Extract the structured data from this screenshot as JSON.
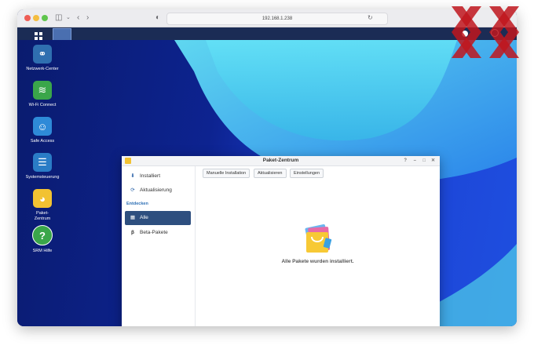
{
  "browser": {
    "address": "192.168.1.238"
  },
  "desktop": {
    "icons": [
      {
        "label": "Netzwerk-Center",
        "icon": "network-globe-icon",
        "color": "#2f6fb0"
      },
      {
        "label": "Wi-Fi Connect",
        "icon": "wifi-icon",
        "color": "#3aa64a"
      },
      {
        "label": "Safe Access",
        "icon": "safe-access-icon",
        "color": "#2e8ad8"
      },
      {
        "label": "Systemsteuerung",
        "icon": "control-panel-icon",
        "color": "#2a7cc6"
      },
      {
        "label": "Paket-\nZentrum",
        "icon": "package-bag-icon",
        "color": "#f2c232"
      },
      {
        "label": "SRM Hilfe",
        "icon": "help-icon",
        "color": "#3aa64a"
      }
    ]
  },
  "window": {
    "title": "Paket-Zentrum",
    "sidebar": {
      "items": [
        {
          "label": "Installiert",
          "icon": "installed-icon"
        },
        {
          "label": "Aktualisierung",
          "icon": "refresh-icon"
        }
      ],
      "section": "Entdecken",
      "discover_items": [
        {
          "label": "Alle",
          "icon": "grid-icon",
          "selected": true
        },
        {
          "label": "Beta-Pakete",
          "icon": "beta-icon"
        }
      ]
    },
    "toolbar": {
      "manual_install": "Manuelle Installation",
      "update": "Aktualisieren",
      "settings": "Einstellungen"
    },
    "empty_message": "Alle Pakete wurden installiert."
  },
  "colors": {
    "selected": "#2e4f7f",
    "section": "#2d6fb5",
    "watermark": "#c0161d"
  }
}
